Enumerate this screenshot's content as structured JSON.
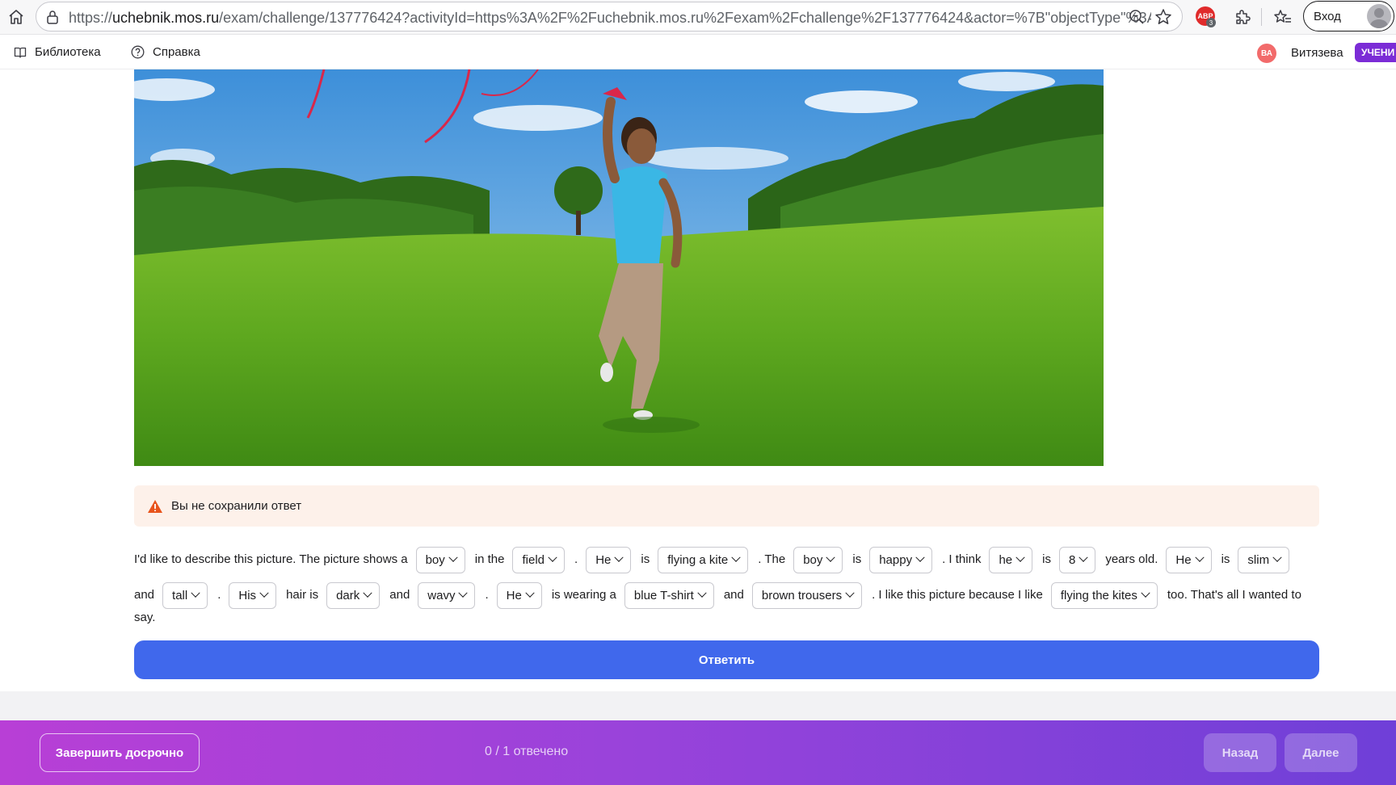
{
  "browser": {
    "url_prefix": "https://",
    "url_host": "uchebnik.mos.ru",
    "url_rest": "/exam/challenge/137776424?activityId=https%3A%2F%2Fuchebnik.mos.ru%2Fexam%2Fchallenge%2F137776424&actor=%7B\"objectType\"%3A...",
    "ext_badge": "ABP",
    "ext_badge_count": "3",
    "login_label": "Вход"
  },
  "header": {
    "library": "Библиотека",
    "help": "Справка",
    "user_initials": "ВА",
    "user_name": "Витязева",
    "role": "УЧЕНИ"
  },
  "warning": {
    "text": "Вы не сохранили ответ"
  },
  "task": {
    "p1": "I'd like to describe this picture. The picture shows a",
    "s1": "boy",
    "p2": "in the",
    "s2": "field",
    "p3": ".",
    "s3": "He",
    "p4": "is",
    "s4": "flying a kite",
    "p5": ". The",
    "s5": "boy",
    "p6": "is",
    "s6": "happy",
    "p7": ". I think",
    "s7": "he",
    "p8": "is",
    "s8": "8",
    "p9": "years old.",
    "s9": "He",
    "p10": "is",
    "s10": "slim",
    "p11": "and",
    "s11": "tall",
    "p12": ".",
    "s12": "His",
    "p13": "hair is",
    "s13": "dark",
    "p14": "and",
    "s14": "wavy",
    "p15": ".",
    "s15": "He",
    "p16": "is wearing a",
    "s16": "blue T-shirt",
    "p17": "and",
    "s17": "brown trousers",
    "p18": ". I like this picture because I like",
    "s18": "flying the kites",
    "p19": "too. That's all I wanted to",
    "p20": "say."
  },
  "answer_button": "Ответить",
  "footer": {
    "finish": "Завершить досрочно",
    "progress": "0 / 1 отвечено",
    "back": "Назад",
    "next": "Далее"
  }
}
